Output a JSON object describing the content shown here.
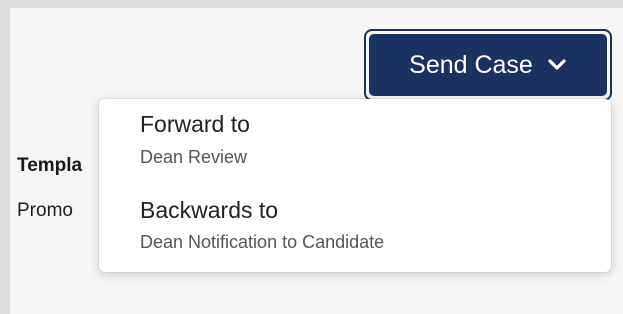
{
  "page": {
    "side_label": "Templa",
    "side_value": "Promo"
  },
  "send_case": {
    "label": "Send Case",
    "icon": "chevron-down-icon",
    "color": "#1b3160"
  },
  "menu": {
    "items": [
      {
        "title": "Forward to",
        "subtitle": "Dean Review"
      },
      {
        "title": "Backwards to",
        "subtitle": "Dean Notification to Candidate"
      }
    ]
  }
}
